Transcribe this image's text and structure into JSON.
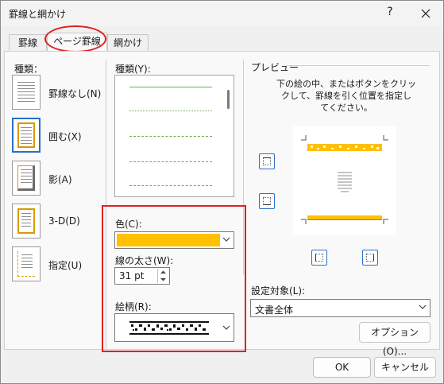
{
  "window": {
    "title": "罫線と網かけ",
    "help": "?"
  },
  "tabs": [
    {
      "label": "罫線"
    },
    {
      "label": "ページ罫線"
    },
    {
      "label": "網かけ"
    }
  ],
  "settings": {
    "heading": "種類：",
    "items": [
      {
        "label": "罫線なし(N)"
      },
      {
        "label": "囲む(X)"
      },
      {
        "label": "影(A)"
      },
      {
        "label": "3-D(D)"
      },
      {
        "label": "指定(U)"
      }
    ]
  },
  "style": {
    "label": "種類(Y):"
  },
  "color": {
    "label": "色(C):",
    "value_hex": "#ffc000"
  },
  "width": {
    "label": "線の太さ(W):",
    "value": "31 pt"
  },
  "art": {
    "label": "絵柄(R):"
  },
  "preview": {
    "label": "プレビュー",
    "info_lines": [
      "下の絵の中、またはボタンをクリッ",
      "クして、罫線を引く位置を指定し",
      "てください。"
    ]
  },
  "apply_to": {
    "label": "設定対象(L):",
    "value": "文書全体"
  },
  "buttons": {
    "options": "オプション(O)...",
    "ok": "OK",
    "cancel": "キャンセル"
  },
  "colors": {
    "accent": "#2a6fc9",
    "annotation": "#e02020",
    "border_color": "#ffc000",
    "style_line": "#70ad47"
  }
}
